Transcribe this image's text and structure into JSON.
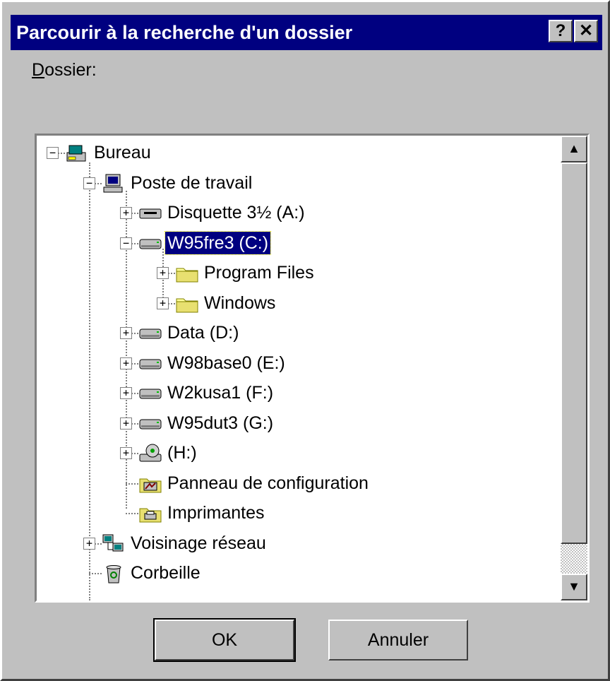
{
  "window": {
    "title": "Parcourir à la recherche d'un dossier",
    "help_button": "?",
    "close_button": "✕"
  },
  "folder_label": {
    "mnemonic": "D",
    "rest": "ossier:"
  },
  "tree": {
    "items": [
      {
        "label": "Bureau",
        "icon": "desktop-icon",
        "expander": "−"
      },
      {
        "label": "Poste de travail",
        "icon": "computer-icon",
        "expander": "−"
      },
      {
        "label": "Disquette 3½ (A:)",
        "icon": "floppy-drive-icon",
        "expander": "+"
      },
      {
        "label": "W95fre3 (C:)",
        "icon": "hard-drive-icon",
        "expander": "−",
        "selected": true
      },
      {
        "label": "Program Files",
        "icon": "folder-icon",
        "expander": "+"
      },
      {
        "label": "Windows",
        "icon": "folder-icon",
        "expander": "+"
      },
      {
        "label": "Data (D:)",
        "icon": "hard-drive-icon",
        "expander": "+"
      },
      {
        "label": "W98base0 (E:)",
        "icon": "hard-drive-icon",
        "expander": "+"
      },
      {
        "label": "W2kusa1 (F:)",
        "icon": "hard-drive-icon",
        "expander": "+"
      },
      {
        "label": "W95dut3 (G:)",
        "icon": "hard-drive-icon",
        "expander": "+"
      },
      {
        "label": "(H:)",
        "icon": "cd-drive-icon",
        "expander": "+"
      },
      {
        "label": "Panneau de configuration",
        "icon": "control-panel-icon",
        "expander": ""
      },
      {
        "label": "Imprimantes",
        "icon": "printers-icon",
        "expander": ""
      },
      {
        "label": "Voisinage réseau",
        "icon": "network-icon",
        "expander": "+"
      },
      {
        "label": "Corbeille",
        "icon": "recycle-bin-icon",
        "expander": ""
      }
    ]
  },
  "scrollbar": {
    "up": "▲",
    "down": "▼"
  },
  "buttons": {
    "ok": "OK",
    "cancel": "Annuler"
  },
  "colors": {
    "face": "#c0c0c0",
    "titlebar": "#000080",
    "selection": "#000080"
  }
}
